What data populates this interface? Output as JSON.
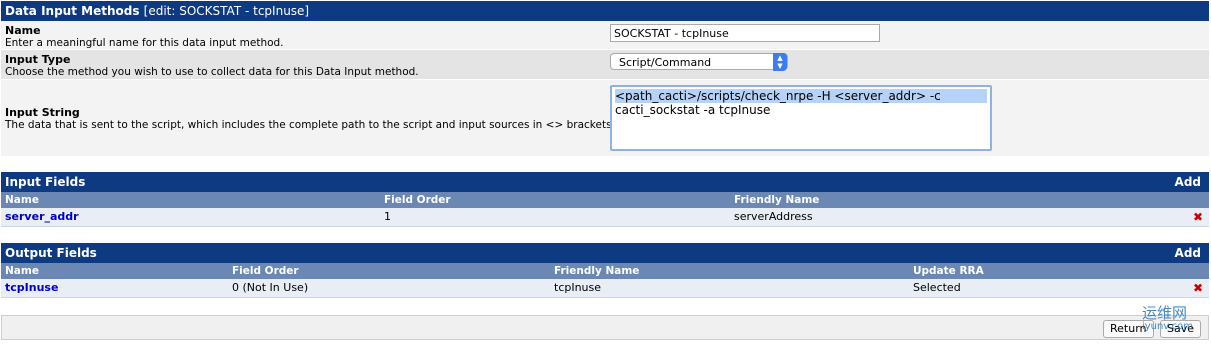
{
  "header": {
    "title": "Data Input Methods",
    "edit": "[edit: SOCKSTAT - tcpInuse]"
  },
  "fields": {
    "name": {
      "label": "Name",
      "desc": "Enter a meaningful name for this data input method.",
      "value": "SOCKSTAT - tcpInuse"
    },
    "input_type": {
      "label": "Input Type",
      "desc": "Choose the method you wish to use to collect data for this Data Input method.",
      "value": "Script/Command"
    },
    "input_string": {
      "label": "Input String",
      "desc": "The data that is sent to the script, which includes the complete path to the script and input sources in <> brackets.",
      "line1": "<path_cacti>/scripts/check_nrpe -H <server_addr> -c",
      "line2": "cacti_sockstat -a tcpInuse"
    }
  },
  "input_fields": {
    "title": "Input Fields",
    "add": "Add",
    "columns": [
      "Name",
      "Field Order",
      "Friendly Name"
    ],
    "rows": [
      {
        "name": "server_addr",
        "order": "1",
        "friendly": "serverAddress",
        "delete": "✖"
      }
    ]
  },
  "output_fields": {
    "title": "Output Fields",
    "add": "Add",
    "columns": [
      "Name",
      "Field Order",
      "Friendly Name",
      "Update RRA"
    ],
    "rows": [
      {
        "name": "tcpInuse",
        "order": "0 (Not In Use)",
        "friendly": "tcpInuse",
        "rra": "Selected",
        "delete": "✖"
      }
    ]
  },
  "buttons": {
    "return": "Return",
    "save": "Save"
  },
  "watermark": {
    "line1": "运维网",
    "line2": "iyunv.com"
  },
  "colors": {
    "header_bg": "#0e3a82",
    "subheader_bg": "#6b87b3",
    "row_bg": "#e9edf5",
    "link": "#0000cc",
    "delete": "#d00000"
  }
}
